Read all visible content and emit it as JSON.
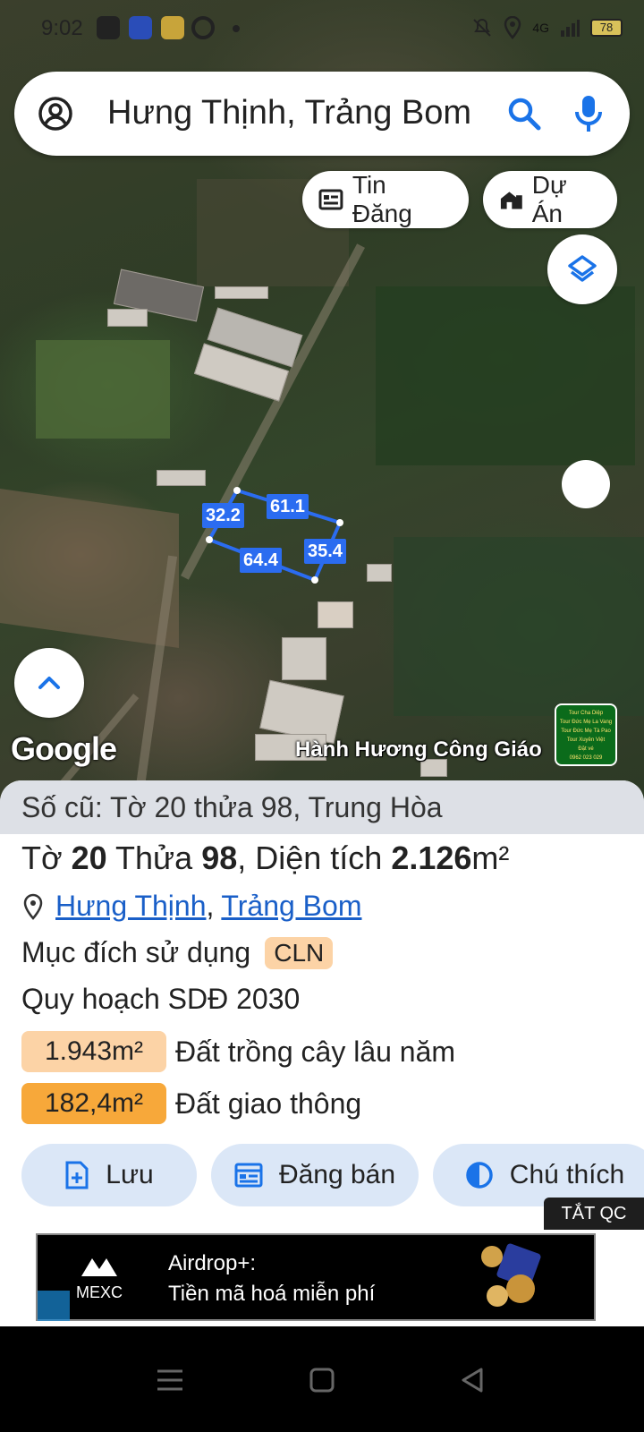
{
  "status_bar": {
    "time": "9:02",
    "network": "4G",
    "battery": "78"
  },
  "search": {
    "query": "Hưng Thịnh, Trảng Bom"
  },
  "map_chips": {
    "listings_label": "Tin Đăng",
    "projects_label": "Dự Án"
  },
  "map": {
    "google_logo": "Google",
    "place_label": "Hành Hương Công Giáo",
    "tour_ad_lines": [
      "Tour Cha Diệp",
      "Tour Đức Mẹ La Vang",
      "Tour Đức Mẹ Tà Pao",
      "Tour Xuyên Việt",
      "Đặt vé",
      "0962 023 029"
    ],
    "parcel_edges": [
      "32.2",
      "61.1",
      "35.4",
      "64.4"
    ]
  },
  "parcel": {
    "old_info": "Số cũ: Tờ 20 thửa 98, Trung Hòa",
    "sheet_label": "Tờ",
    "sheet_number": "20",
    "plot_label": "Thửa",
    "plot_number": "98",
    "area_label": ", Diện tích",
    "area_value": "2.126",
    "area_unit": "m²",
    "ward": "Hưng Thịnh",
    "district": "Trảng Bom",
    "separator": ",",
    "purpose_label": "Mục đích sử dụng",
    "purpose_code": "CLN",
    "planning_label": "Quy hoạch SDĐ 2030",
    "planning_items": [
      {
        "area": "1.943m²",
        "name": "Đất trồng cây lâu năm",
        "color": "#fcd3a6"
      },
      {
        "area": "182,4m²",
        "name": "Đất giao thông",
        "color": "#f7a83a"
      }
    ]
  },
  "actions": {
    "save": "Lưu",
    "post_sale": "Đăng bán",
    "legend": "Chú thích"
  },
  "ad": {
    "off_label": "TẮT QC",
    "brand": "MEXC",
    "line1": "Airdrop+:",
    "line2": "Tiền mã hoá miễn phí"
  },
  "colors": {
    "accent": "#1a73e8",
    "parcel_outline": "#2b6cf0",
    "link": "#1a5fc8"
  }
}
